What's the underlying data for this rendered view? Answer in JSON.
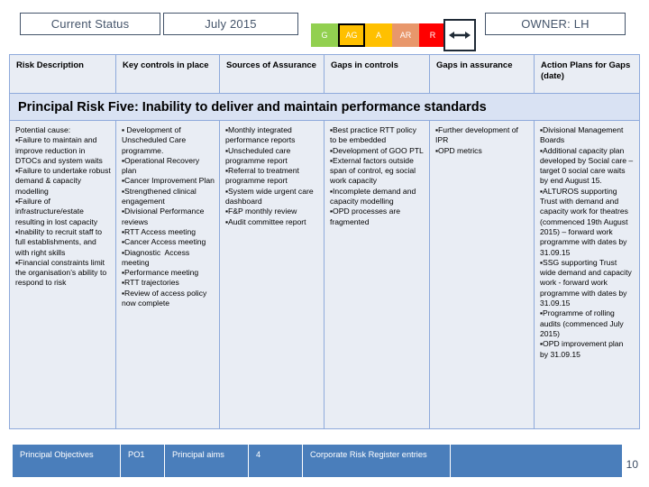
{
  "topbar": {
    "status_label": "Current Status",
    "period_label": "July 2015",
    "owner_label": "OWNER: LH",
    "rag": [
      {
        "code": "G",
        "color": "#92D050",
        "selected": false
      },
      {
        "code": "AG",
        "color": "#FFC000",
        "selected": true
      },
      {
        "code": "A",
        "color": "#FFC000",
        "selected": false
      },
      {
        "code": "AR",
        "color": "#E8976B",
        "selected": false
      },
      {
        "code": "R",
        "color": "#FF0000",
        "selected": false
      }
    ],
    "trend_icon": "left-right-arrow-icon"
  },
  "table": {
    "headers": [
      "Risk Description",
      "Key controls in place",
      "Sources of Assurance",
      "Gaps in controls",
      "Gaps in assurance",
      "Action Plans for Gaps (date)"
    ],
    "title": "Principal Risk Five: Inability to deliver and maintain performance standards",
    "columns": {
      "risk_description": "Potential cause:\n▪Failure to maintain and improve reduction in DTOCs and system waits\n▪Failure to undertake robust demand & capacity modelling\n▪Failure of infrastructure/estate resulting in lost capacity\n▪Inability to recruit staff to full establishments, and with right skills\n▪Financial constraints limit the organisation’s ability to respond to risk",
      "key_controls": "▪ Development of Unscheduled Care programme.\n▪Operational Recovery plan\n▪Cancer Improvement Plan\n▪Strengthened clinical engagement\n▪Divisional Performance reviews\n▪RTT Access meeting\n▪Cancer Access meeting\n▪Diagnostic  Access meeting\n▪Performance meeting\n▪RTT trajectories\n▪Review of access policy now complete",
      "sources_of_assurance": "▪Monthly integrated performance reports\n▪Unscheduled care programme report\n▪Referral to treatment programme report\n▪System wide urgent care dashboard\n▪F&P monthly review\n▪Audit committee report",
      "gaps_in_controls": "▪Best practice RTT policy to be embedded\n▪Development of GOO PTL\n▪External factors outside span of control, eg social work capacity\n▪Incomplete demand and capacity modelling\n▪OPD processes are fragmented",
      "gaps_in_assurance": "▪Further development of IPR\n▪OPD metrics",
      "action_plans": "▪Divisional Management Boards\n▪Additional capacity plan developed by Social care – target 0 social care waits by end August 15.\n▪ALTUROS supporting Trust with demand and capacity work for theatres (commenced 19th August 2015) – forward work programme with dates by 31.09.15\n▪SSG supporting Trust wide demand and capacity work - forward work programme with dates by 31.09.15\n▪Programme of rolling audits (commenced July 2015)\n▪OPD improvement plan  by 31.09.15"
    }
  },
  "footer": {
    "cells": [
      "Principal Objectives",
      "PO1",
      "Principal aims",
      "4",
      "Corporate Risk Register entries",
      ""
    ]
  },
  "slide_number": "10"
}
